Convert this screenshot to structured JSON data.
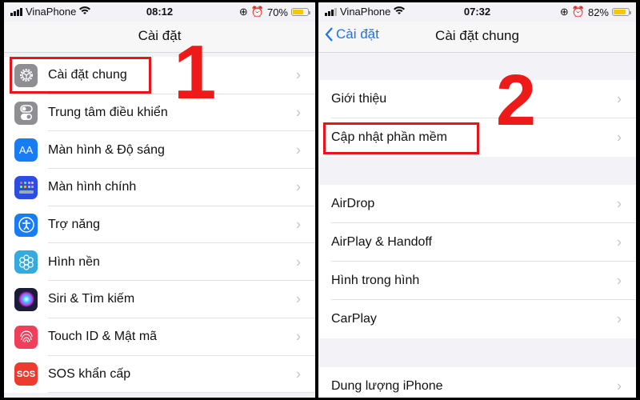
{
  "left_screen": {
    "status": {
      "carrier": "VinaPhone",
      "time": "08:12",
      "battery": "70%"
    },
    "nav_title": "Cài đặt",
    "items": [
      {
        "label": "Cài đặt chung",
        "icon": "gear-icon",
        "color": "#8e8e93"
      },
      {
        "label": "Trung tâm điều khiển",
        "icon": "toggles-icon",
        "color": "#8e8e93"
      },
      {
        "label": "Màn hình & Độ sáng",
        "icon": "text-size-icon",
        "color": "#1a7cf5"
      },
      {
        "label": "Màn hình chính",
        "icon": "home-grid-icon",
        "color": "#2b4de0"
      },
      {
        "label": "Trợ năng",
        "icon": "accessibility-icon",
        "color": "#1a7cf5"
      },
      {
        "label": "Hình nền",
        "icon": "flower-icon",
        "color": "#35aadc"
      },
      {
        "label": "Siri & Tìm kiếm",
        "icon": "siri-icon",
        "color": "#1c1c3a"
      },
      {
        "label": "Touch ID & Mật mã",
        "icon": "fingerprint-icon",
        "color": "#f03e5b"
      },
      {
        "label": "SOS khẩn cấp",
        "icon": "sos-icon",
        "color": "#ef3b2f",
        "icon_text": "SOS"
      }
    ],
    "step_number": "1"
  },
  "right_screen": {
    "status": {
      "carrier": "VinaPhone",
      "time": "07:32",
      "battery": "82%"
    },
    "back_label": "Cài đặt",
    "nav_title": "Cài đặt chung",
    "groups": [
      [
        "Giới thiệu",
        "Cập nhật phần mềm"
      ],
      [
        "AirDrop",
        "AirPlay & Handoff",
        "Hình trong hình",
        "CarPlay"
      ],
      [
        "Dung lượng iPhone"
      ]
    ],
    "step_number": "2"
  },
  "colors": {
    "highlight": "#e8141c",
    "accent": "#1a73e8"
  }
}
